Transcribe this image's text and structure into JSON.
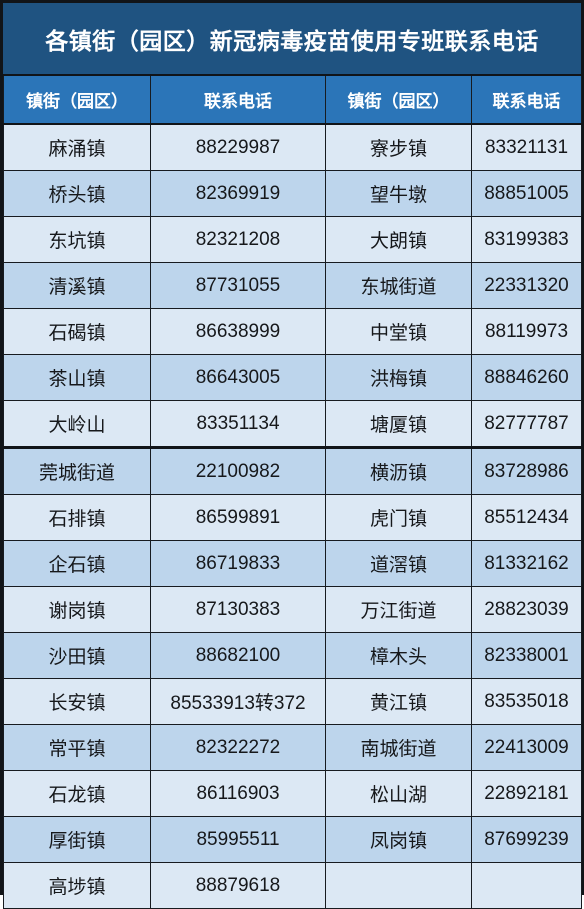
{
  "title": "各镇街（园区）新冠病毒疫苗使用专班联系电话",
  "colors": {
    "title_bg": "#1f5381",
    "title_fg": "#ffffff",
    "header_bg": "#2b75b8",
    "header_fg": "#ffffff",
    "row_light": "#dce8f4",
    "row_dark": "#bdd5ec",
    "grid_line": "#171b20",
    "text": "#16181b"
  },
  "headers": [
    "镇街（园区）",
    "联系电话",
    "镇街（园区）",
    "联系电话"
  ],
  "rows": [
    {
      "town_left": "麻涌镇",
      "phone_left": "88229987",
      "town_right": "寮步镇",
      "phone_right": "83321131"
    },
    {
      "town_left": "桥头镇",
      "phone_left": "82369919",
      "town_right": "望牛墩",
      "phone_right": "88851005"
    },
    {
      "town_left": "东坑镇",
      "phone_left": "82321208",
      "town_right": "大朗镇",
      "phone_right": "83199383"
    },
    {
      "town_left": "清溪镇",
      "phone_left": "87731055",
      "town_right": "东城街道",
      "phone_right": "22331320"
    },
    {
      "town_left": "石碣镇",
      "phone_left": "86638999",
      "town_right": "中堂镇",
      "phone_right": "88119973"
    },
    {
      "town_left": "茶山镇",
      "phone_left": "86643005",
      "town_right": "洪梅镇",
      "phone_right": "88846260"
    },
    {
      "town_left": "大岭山",
      "phone_left": "83351134",
      "town_right": "塘厦镇",
      "phone_right": "82777787"
    },
    {
      "town_left": "莞城街道",
      "phone_left": "22100982",
      "town_right": "横沥镇",
      "phone_right": "83728986"
    },
    {
      "town_left": "石排镇",
      "phone_left": "86599891",
      "town_right": "虎门镇",
      "phone_right": "85512434"
    },
    {
      "town_left": "企石镇",
      "phone_left": "86719833",
      "town_right": "道滘镇",
      "phone_right": "81332162"
    },
    {
      "town_left": "谢岗镇",
      "phone_left": "87130383",
      "town_right": "万江街道",
      "phone_right": "28823039"
    },
    {
      "town_left": "沙田镇",
      "phone_left": "88682100",
      "town_right": "樟木头",
      "phone_right": "82338001"
    },
    {
      "town_left": "长安镇",
      "phone_left": "85533913转372",
      "town_right": "黄江镇",
      "phone_right": "83535018"
    },
    {
      "town_left": "常平镇",
      "phone_left": "82322272",
      "town_right": "南城街道",
      "phone_right": "22413009"
    },
    {
      "town_left": "石龙镇",
      "phone_left": "86116903",
      "town_right": "松山湖",
      "phone_right": "22892181"
    },
    {
      "town_left": "厚街镇",
      "phone_left": "85995511",
      "town_right": "凤岗镇",
      "phone_right": "87699239"
    },
    {
      "town_left": "高埗镇",
      "phone_left": "88879618",
      "town_right": "",
      "phone_right": ""
    }
  ]
}
